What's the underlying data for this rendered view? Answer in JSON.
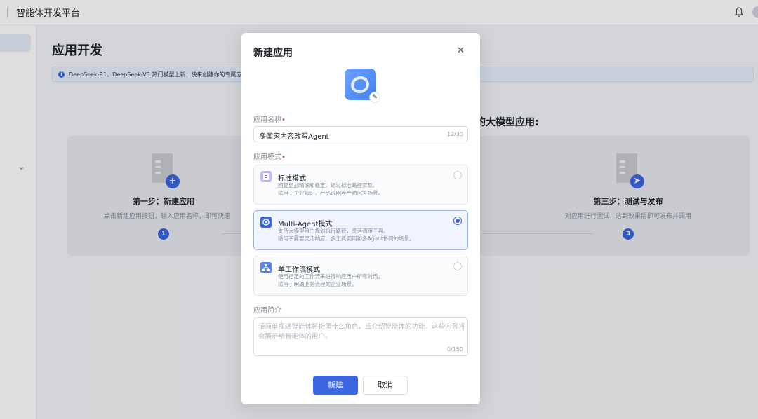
{
  "topbar": {
    "brand": "智能体开发平台"
  },
  "page": {
    "title": "应用开发",
    "notice": "DeepSeek-R1、DeepSeek-V3 热门模型上新，快来创建你的专属应",
    "section_heading": "的大模型应用:",
    "steps": [
      {
        "title": "第一步：新建应用",
        "desc": "点击新建应用按钮，输入应用名称，即可快速",
        "num": "1"
      },
      {
        "title": "第三步：测试与发布",
        "desc": "对应用进行测试，达到效果后即可发布并调用",
        "num": "3"
      }
    ]
  },
  "modal": {
    "title": "新建应用",
    "name_label": "应用名称",
    "name_value": "多国家内容改写Agent",
    "name_count": "12/30",
    "mode_label": "应用模式",
    "modes": [
      {
        "title": "标准模式",
        "desc1": "回复更加精确和稳定，通过标准路径实现。",
        "desc2": "适用于企业知识、产品说明等严肃问答场景。",
        "selected": false
      },
      {
        "title": "Multi-Agent模式",
        "desc1": "支持大模型自主规划执行路径，灵活调用工具。",
        "desc2": "适用于需要灵活响应、多工具调用和多Agent协同的场景。",
        "selected": true
      },
      {
        "title": "单工作流模式",
        "desc1": "使用指定的工作流来进行响应用户所有对话。",
        "desc2": "适用于明确业务流程的企业场景。",
        "selected": false
      }
    ],
    "intro_label": "应用简介",
    "intro_placeholder": "请简单描述智能体将扮演什么角色，或介绍智能体的功能。这些内容将会展示给智能体的用户。",
    "intro_count": "0/150",
    "confirm_label": "新建",
    "cancel_label": "取消"
  },
  "colors": {
    "accent": "#3a66e0",
    "required": "#e54545"
  },
  "icons": [
    "bell-icon",
    "chevron-down-icon",
    "info-icon",
    "close-icon",
    "edit-icon",
    "standard-mode-icon",
    "multi-agent-icon",
    "workflow-icon"
  ]
}
